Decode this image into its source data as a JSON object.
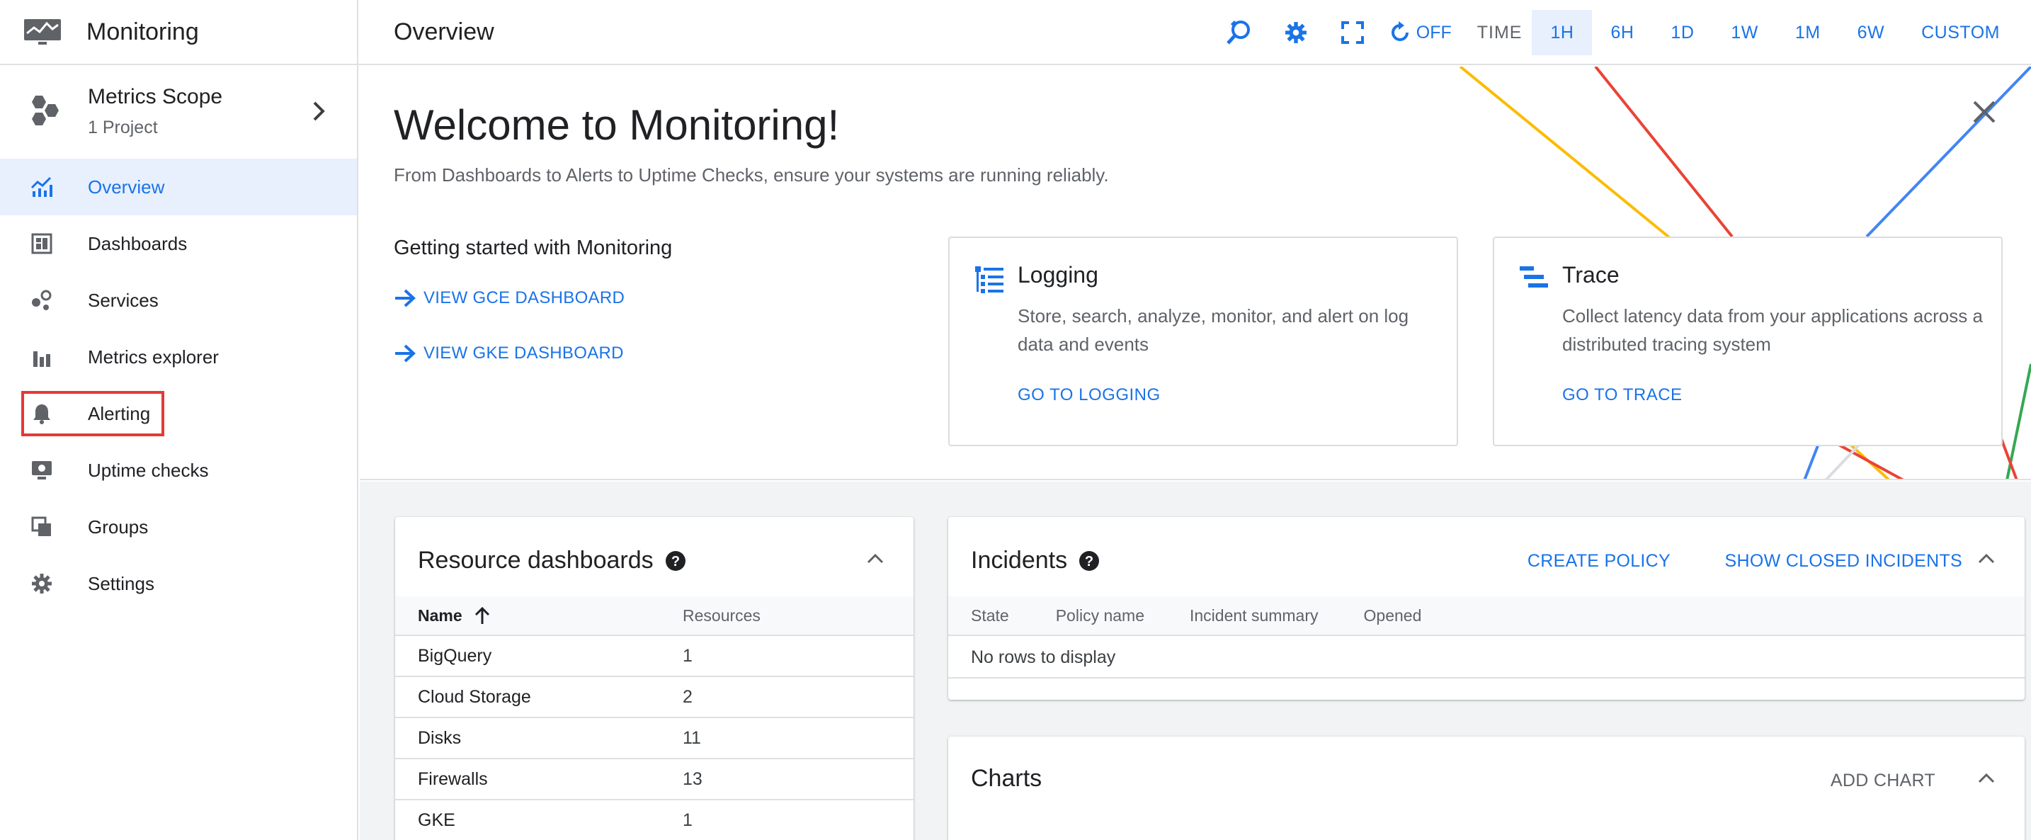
{
  "app": {
    "title": "Monitoring",
    "icon": "monitor-icon"
  },
  "scope": {
    "title": "Metrics Scope",
    "subtitle": "1 Project",
    "icon": "hexagons-icon"
  },
  "nav": [
    {
      "label": "Overview",
      "icon": "chart-line-icon",
      "active": true
    },
    {
      "label": "Dashboards",
      "icon": "dashboard-icon"
    },
    {
      "label": "Services",
      "icon": "services-icon"
    },
    {
      "label": "Metrics explorer",
      "icon": "bar-chart-icon"
    },
    {
      "label": "Alerting",
      "icon": "bell-icon",
      "highlighted": true
    },
    {
      "label": "Uptime checks",
      "icon": "uptime-monitor-icon"
    },
    {
      "label": "Groups",
      "icon": "groups-icon"
    },
    {
      "label": "Settings",
      "icon": "gear-icon"
    }
  ],
  "topbar": {
    "title": "Overview",
    "refresh_label": "OFF",
    "time_label": "TIME",
    "time_ranges": [
      "1H",
      "6H",
      "1D",
      "1W",
      "1M",
      "6W",
      "CUSTOM"
    ],
    "selected_time_range": "1H"
  },
  "welcome": {
    "title": "Welcome to Monitoring!",
    "subtitle": "From Dashboards to Alerts to Uptime Checks, ensure your systems are running reliably.",
    "getting_started": {
      "title": "Getting started with Monitoring",
      "links": [
        "VIEW GCE DASHBOARD",
        "VIEW GKE DASHBOARD"
      ]
    },
    "cards": [
      {
        "title": "Logging",
        "description": "Store, search, analyze, monitor, and alert on log data and events",
        "link": "GO TO LOGGING",
        "icon": "logging-icon"
      },
      {
        "title": "Trace",
        "description": "Collect latency data from your applications across a distributed tracing system",
        "link": "GO TO TRACE",
        "icon": "trace-icon"
      }
    ],
    "decor_colors": [
      "#fbbc04",
      "#ea4335",
      "#4285f4",
      "#34a853",
      "#dadce0"
    ]
  },
  "resource_dashboards": {
    "title": "Resource dashboards",
    "columns": [
      "Name",
      "Resources"
    ],
    "rows": [
      {
        "name": "BigQuery",
        "resources": "1"
      },
      {
        "name": "Cloud Storage",
        "resources": "2"
      },
      {
        "name": "Disks",
        "resources": "11"
      },
      {
        "name": "Firewalls",
        "resources": "13"
      },
      {
        "name": "GKE",
        "resources": "1"
      }
    ]
  },
  "incidents": {
    "title": "Incidents",
    "actions": [
      "CREATE POLICY",
      "SHOW CLOSED INCIDENTS"
    ],
    "columns": [
      "State",
      "Policy name",
      "Incident summary",
      "Opened"
    ],
    "empty_message": "No rows to display"
  },
  "charts": {
    "title": "Charts",
    "action": "ADD CHART"
  },
  "colors": {
    "accent": "#1a73e8",
    "highlight_box": "#e53935",
    "active_bg": "#e8f0fe"
  }
}
